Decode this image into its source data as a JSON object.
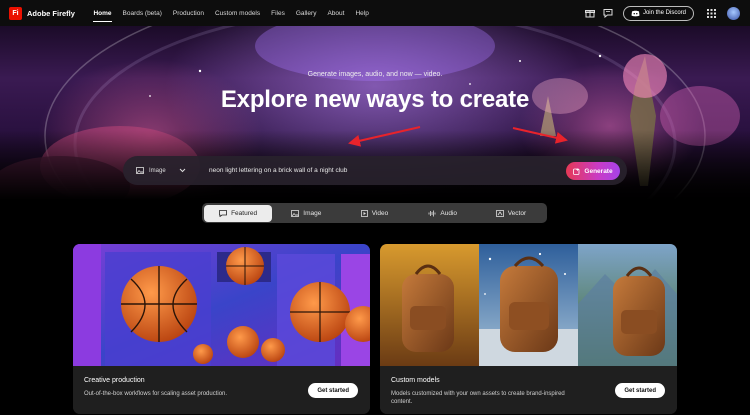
{
  "brand": {
    "name": "Adobe Firefly",
    "logo_text": "Fi"
  },
  "nav": {
    "links": [
      {
        "label": "Home"
      },
      {
        "label": "Boards (beta)"
      },
      {
        "label": "Production"
      },
      {
        "label": "Custom models"
      },
      {
        "label": "Files"
      },
      {
        "label": "Gallery"
      },
      {
        "label": "About"
      },
      {
        "label": "Help"
      }
    ],
    "active": "Home",
    "discord_label": "Join the Discord",
    "icons": [
      "gift-icon",
      "chat-icon",
      "discord-icon",
      "apps-grid-icon",
      "avatar"
    ]
  },
  "hero": {
    "subtitle": "Generate images, audio, and now — video.",
    "title": "Explore new ways to create",
    "type_select": "Image",
    "prompt_value": "neon light lettering on a brick wall of a night club",
    "generate_label": "Generate"
  },
  "tabs": [
    {
      "label": "Featured"
    },
    {
      "label": "Image"
    },
    {
      "label": "Video"
    },
    {
      "label": "Audio"
    },
    {
      "label": "Vector"
    }
  ],
  "cards": [
    {
      "title": "Creative production",
      "description": "Out-of-the-box workflows for scaling asset production.",
      "button": "Get started"
    },
    {
      "title": "Custom models",
      "description": "Models customized with your own assets to create brand-inspired content.",
      "button": "Get started"
    }
  ],
  "colors": {
    "accent_red": "#eb1000",
    "generate_start": "#e53955",
    "generate_end": "#a643e8",
    "annotation_arrow": "#e8232b"
  }
}
